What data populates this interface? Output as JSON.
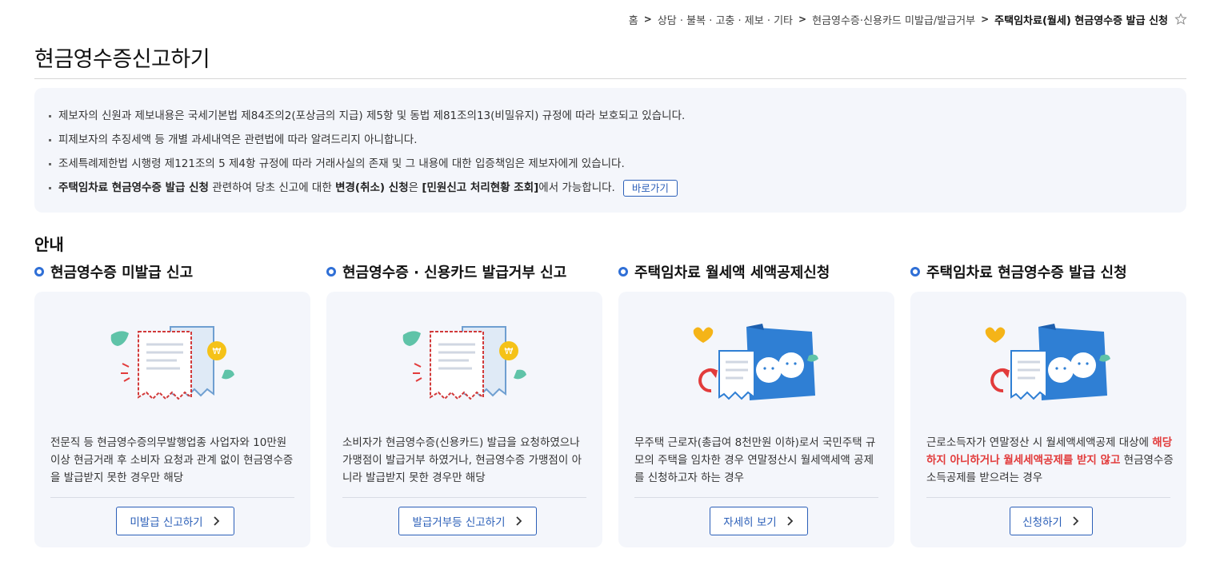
{
  "breadcrumb": {
    "items": [
      "홈",
      "상담 · 불복 · 고충 · 제보 · 기타",
      "현금영수증·신용카드 미발급/발급거부"
    ],
    "current": "주택임차료(월세) 현금영수증 발급 신청",
    "separator": ">",
    "star_icon": "star-outline-icon"
  },
  "page": {
    "title": "현금영수증신고하기"
  },
  "notice": {
    "items": [
      "제보자의 신원과 제보내용은 국세기본법 제84조의2(포상금의 지급) 제5항 및 동법 제81조의13(비밀유지) 규정에 따라 보호되고 있습니다.",
      "피제보자의 추징세액 등 개별 과세내역은 관련법에 따라 알려드리지 아니합니다.",
      "조세특례제한법 시행령 제121조의 5 제4항 규정에 따라 거래사실의 존재 및 그 내용에 대한 입증책임은 제보자에게 있습니다."
    ],
    "last": {
      "bold1": "주택임차료 현금영수증 발급 신청",
      "text1": " 관련하여 당초 신고에 대한 ",
      "bold2": "변경(취소) 신청",
      "text2": "은 ",
      "bold3": "[민원신고 처리현황 조회]",
      "text3": "에서 가능합니다.",
      "button": "바로가기"
    }
  },
  "guide": {
    "title": "안내",
    "cards": [
      {
        "heading": "현금영수증 미발급 신고",
        "text": "전문직 등 현금영수증의무발행업종 사업자와 10만원 이상 현금거래 후 소비자 요청과 관계 없이 현금영수증을 발급받지 못한 경우만 해당",
        "button": "미발급 신고하기",
        "icon": "receipt-illustration"
      },
      {
        "heading": "현금영수증 · 신용카드 발급거부 신고",
        "text": "소비자가 현금영수증(신용카드) 발급을 요청하였으나 가맹점이 발급거부 하였거나, 현금영수증 가맹점이 아니라 발급받지 못한 경우만 해당",
        "button": "발급거부등 신고하기",
        "icon": "receipt-illustration"
      },
      {
        "heading": "주택임차료 월세액 세액공제신청",
        "text": "무주택 근로자(총급여 8천만원 이하)로서 국민주택 규모의 주택을 임차한 경우 연말정산시 월세액세액 공제를 신청하고자 하는 경우",
        "button": "자세히 보기",
        "icon": "refund-illustration"
      },
      {
        "heading": "주택임차료 현금영수증 발급 신청",
        "text_before": "근로소득자가 연말정산 시 월세액세액공제 대상에 ",
        "text_highlight": "해당하지 아니하거나 월세세액공제를 받지 않고",
        "text_after": " 현금영수증 소득공제를 받으려는 경우",
        "button": "신청하기",
        "icon": "refund-illustration"
      }
    ]
  },
  "colors": {
    "accent": "#2b5fb8",
    "ring": "#2f6fd6",
    "highlight": "#e23b3b",
    "panel": "#f4f6fb"
  }
}
